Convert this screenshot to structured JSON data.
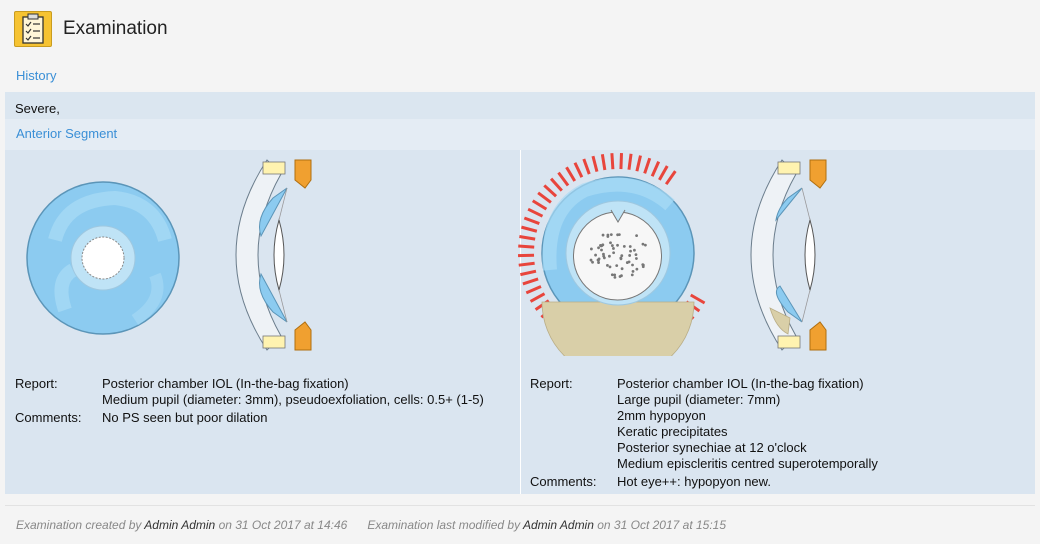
{
  "header": {
    "title": "Examination",
    "icon": "clipboard-checklist-icon"
  },
  "history": {
    "label": "History",
    "text": "Severe,"
  },
  "anterior_segment": {
    "label": "Anterior Segment",
    "right_eye": {
      "report_label": "Report:",
      "report_lines": [
        "Posterior chamber IOL (In-the-bag fixation)",
        "Medium pupil (diameter: 3mm), pseudoexfoliation, cells: 0.5+ (1-5)"
      ],
      "comments_label": "Comments:",
      "comments": "No PS seen but poor dilation"
    },
    "left_eye": {
      "report_label": "Report:",
      "report_lines": [
        "Posterior chamber IOL (In-the-bag fixation)",
        "Large pupil (diameter: 7mm)",
        "2mm hypopyon",
        "Keratic precipitates",
        "Posterior synechiae at 12 o'clock",
        "Medium episcleritis centred superotemporally"
      ],
      "comments_label": "Comments:",
      "comments": "Hot eye++: hypopyon new."
    }
  },
  "footer": {
    "created_prefix": "Examination created by",
    "created_by": "Admin Admin",
    "created_on": "on 31 Oct 2017 at 14:46",
    "modified_prefix": "Examination last modified by",
    "modified_by": "Admin Admin",
    "modified_on": "on 31 Oct 2017 at 15:15"
  },
  "colors": {
    "link": "#3a8fd6",
    "panel": "#dae5f0",
    "iris": "#8ccbf0",
    "episcleritis": "#e8453c",
    "hypopyon": "#d9cfa8",
    "lens": "#f0a030"
  }
}
